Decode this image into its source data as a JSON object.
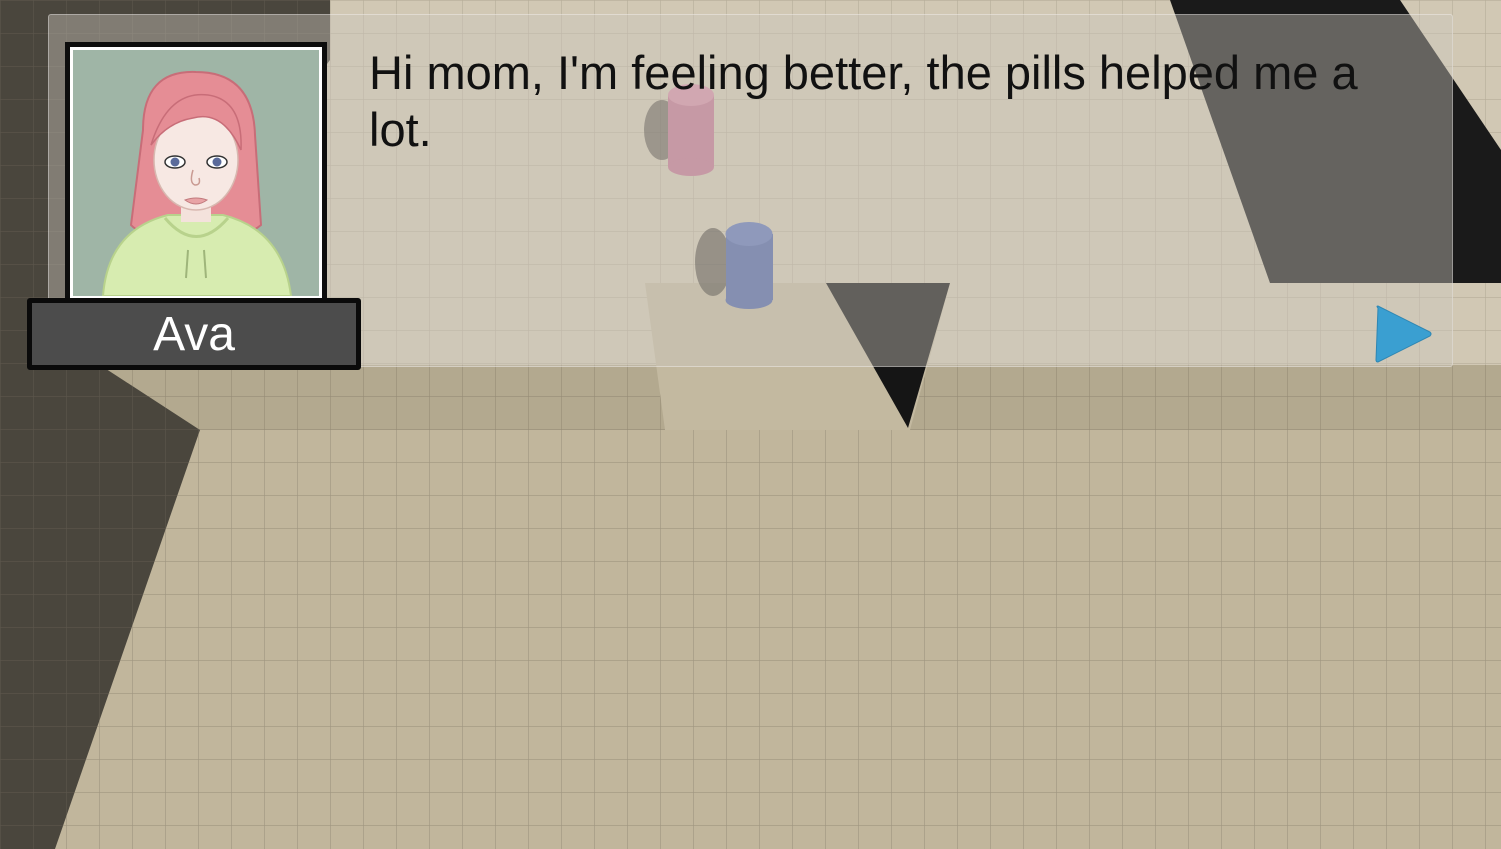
{
  "dialog": {
    "speaker_name": "Ava",
    "text": "Hi mom, I'm feeling better, the pills helped me a lot."
  },
  "portrait": {
    "icon": "character-portrait",
    "background_color": "#9fb5a6",
    "hair_color": "#e58d95",
    "hoodie_color": "#d7ecb0"
  },
  "controls": {
    "next_icon": "play-arrow-icon",
    "next_color": "#3a9fd1"
  },
  "scene": {
    "floor_color": "#c0b59b",
    "pink_cylinder_color": "#c87a98",
    "blue_cylinder_color": "#5b6fb0"
  }
}
